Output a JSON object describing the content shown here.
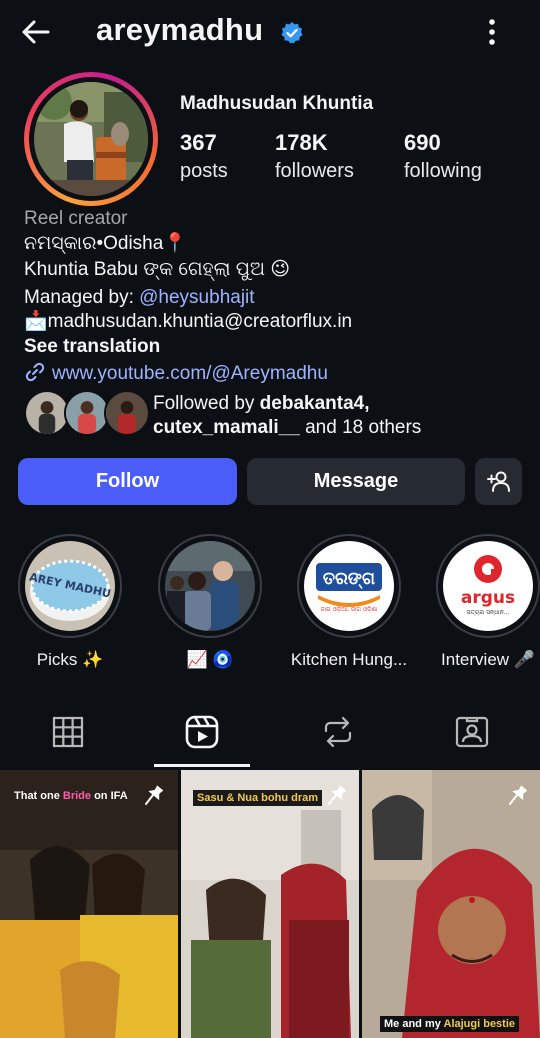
{
  "header": {
    "username": "areymadhu",
    "back_icon": "arrow-left-icon",
    "verified_icon": "verified-badge-icon",
    "menu_icon": "more-vertical-icon"
  },
  "profile": {
    "full_name": "Madhusudan Khuntia",
    "stats": [
      {
        "value": "367",
        "label": "posts"
      },
      {
        "value": "178K",
        "label": "followers"
      },
      {
        "value": "690",
        "label": "following"
      }
    ]
  },
  "bio": {
    "category": "Reel creator",
    "line1": "ନମସ୍କାର•Odisha📍",
    "line2": "Khuntia Babu ଙ୍କ ଗେହ୍ଲା ପୁଅ 😉",
    "managed_prefix": "Managed by: ",
    "managed_handle": "@heysubhajit",
    "email": "📩madhusudan.khuntia@creatorflux.in",
    "see_translation": "See translation",
    "link": "www.youtube.com/@Areymadhu"
  },
  "followed_by": {
    "prefix": "Followed by ",
    "user1": "debakanta4",
    "sep": ",",
    "user2": "cutex_mamali__",
    "suffix": " and 18 others"
  },
  "actions": {
    "follow": "Follow",
    "message": "Message",
    "add_user_icon": "person-add-icon"
  },
  "highlights": [
    {
      "label": "Picks ✨"
    },
    {
      "label": "📈 🧿"
    },
    {
      "label": "Kitchen Hung..."
    },
    {
      "label": "Interview 🎤"
    }
  ],
  "highlight_art": {
    "cake_text": "AREY MADHU",
    "tarang_brand": "ତରଙ୍ଗ",
    "tarang_tagline": "ଜାଗ ଓଡ଼ିଆ, ଜାଗ ଓଡ଼ିଶା",
    "argus_brand": "argus",
    "argus_tagline": "ସତ୍ୟର ସନ୍ଧାନ..."
  },
  "tabs": [
    {
      "name": "grid",
      "icon": "grid-icon"
    },
    {
      "name": "reels",
      "icon": "reels-icon",
      "active": true
    },
    {
      "name": "reposts",
      "icon": "repost-icon"
    },
    {
      "name": "tagged",
      "icon": "tagged-person-icon"
    }
  ],
  "posts": [
    {
      "caption_a": "That one ",
      "caption_b": "Bride",
      "caption_c": " on IFA"
    },
    {
      "caption_a": "Sasu & Nua bohu dram",
      "caption_b": "",
      "caption_c": ""
    },
    {
      "caption_a": "Me and my ",
      "caption_b": "Alajugi bestie",
      "caption_c": ""
    }
  ],
  "colors": {
    "background": "#0c0f14",
    "follow_button": "#4a5df9",
    "secondary_button": "#262a31",
    "link": "#9fb4ff",
    "verified": "#3897f0"
  }
}
